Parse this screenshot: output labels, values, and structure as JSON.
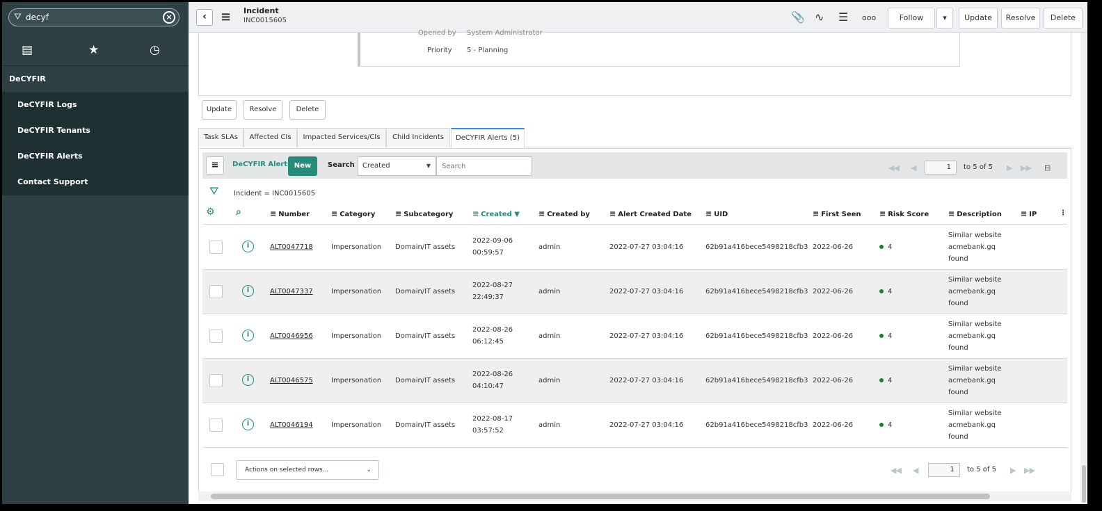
{
  "sidebar": {
    "filter_value": "decyf",
    "section": "DeCYFIR",
    "items": [
      {
        "label": "DeCYFIR Logs"
      },
      {
        "label": "DeCYFIR Tenants"
      },
      {
        "label": "DeCYFIR Alerts"
      },
      {
        "label": "Contact Support"
      }
    ]
  },
  "header": {
    "title": "Incident",
    "number": "INC0015605",
    "follow": "Follow",
    "update": "Update",
    "resolve": "Resolve",
    "delete": "Delete"
  },
  "form": {
    "opened_by_label": "Opened by",
    "opened_by_value": "System Administrator",
    "priority_label": "Priority",
    "priority_value": "5 - Planning"
  },
  "form_buttons": {
    "update": "Update",
    "resolve": "Resolve",
    "delete": "Delete"
  },
  "tabs": [
    {
      "label": "Task SLAs"
    },
    {
      "label": "Affected CIs"
    },
    {
      "label": "Impacted Services/CIs"
    },
    {
      "label": "Child Incidents"
    },
    {
      "label": "DeCYFIR Alerts (5)"
    }
  ],
  "list": {
    "title": "DeCYFIR Alerts",
    "new_label": "New",
    "search_label": "Search",
    "search_field": "Created",
    "search_placeholder": "Search",
    "page": "1",
    "page_text": "to 5 of 5",
    "breadcrumb": "Incident = INC0015605",
    "columns": [
      "Number",
      "Category",
      "Subcategory",
      "Created",
      "Created by",
      "Alert Created Date",
      "UID",
      "First Seen",
      "Risk Score",
      "Description",
      "IP"
    ],
    "rows": [
      {
        "number": "ALT0047718",
        "category": "Impersonation",
        "subcategory": "Domain/IT assets",
        "created_date": "2022-09-06",
        "created_time": "00:59:57",
        "created_by": "admin",
        "alert_created": "2022-07-27 03:04:16",
        "uid": "62b91a416bece5498218cfb3",
        "first_seen": "2022-06-26",
        "risk": "4",
        "desc1": "Similar website",
        "desc2": "acmebank.gq",
        "desc3": "found"
      },
      {
        "number": "ALT0047337",
        "category": "Impersonation",
        "subcategory": "Domain/IT assets",
        "created_date": "2022-08-27",
        "created_time": "22:49:37",
        "created_by": "admin",
        "alert_created": "2022-07-27 03:04:16",
        "uid": "62b91a416bece5498218cfb3",
        "first_seen": "2022-06-26",
        "risk": "4",
        "desc1": "Similar website",
        "desc2": "acmebank.gq",
        "desc3": "found"
      },
      {
        "number": "ALT0046956",
        "category": "Impersonation",
        "subcategory": "Domain/IT assets",
        "created_date": "2022-08-26",
        "created_time": "06:12:45",
        "created_by": "admin",
        "alert_created": "2022-07-27 03:04:16",
        "uid": "62b91a416bece5498218cfb3",
        "first_seen": "2022-06-26",
        "risk": "4",
        "desc1": "Similar website",
        "desc2": "acmebank.gq",
        "desc3": "found"
      },
      {
        "number": "ALT0046575",
        "category": "Impersonation",
        "subcategory": "Domain/IT assets",
        "created_date": "2022-08-26",
        "created_time": "04:10:47",
        "created_by": "admin",
        "alert_created": "2022-07-27 03:04:16",
        "uid": "62b91a416bece5498218cfb3",
        "first_seen": "2022-06-26",
        "risk": "4",
        "desc1": "Similar website",
        "desc2": "acmebank.gq",
        "desc3": "found"
      },
      {
        "number": "ALT0046194",
        "category": "Impersonation",
        "subcategory": "Domain/IT assets",
        "created_date": "2022-08-17",
        "created_time": "03:57:52",
        "created_by": "admin",
        "alert_created": "2022-07-27 03:04:16",
        "uid": "62b91a416bece5498218cfb3",
        "first_seen": "2022-06-26",
        "risk": "4",
        "desc1": "Similar website",
        "desc2": "acmebank.gq",
        "desc3": "found"
      }
    ],
    "actions_label": "Actions on selected rows...",
    "risk_dot_color": "#1a7f37"
  },
  "colors": {
    "sidebar_bg": "#2e4043",
    "accent": "#278b7c",
    "tab_active": "#278efc"
  }
}
